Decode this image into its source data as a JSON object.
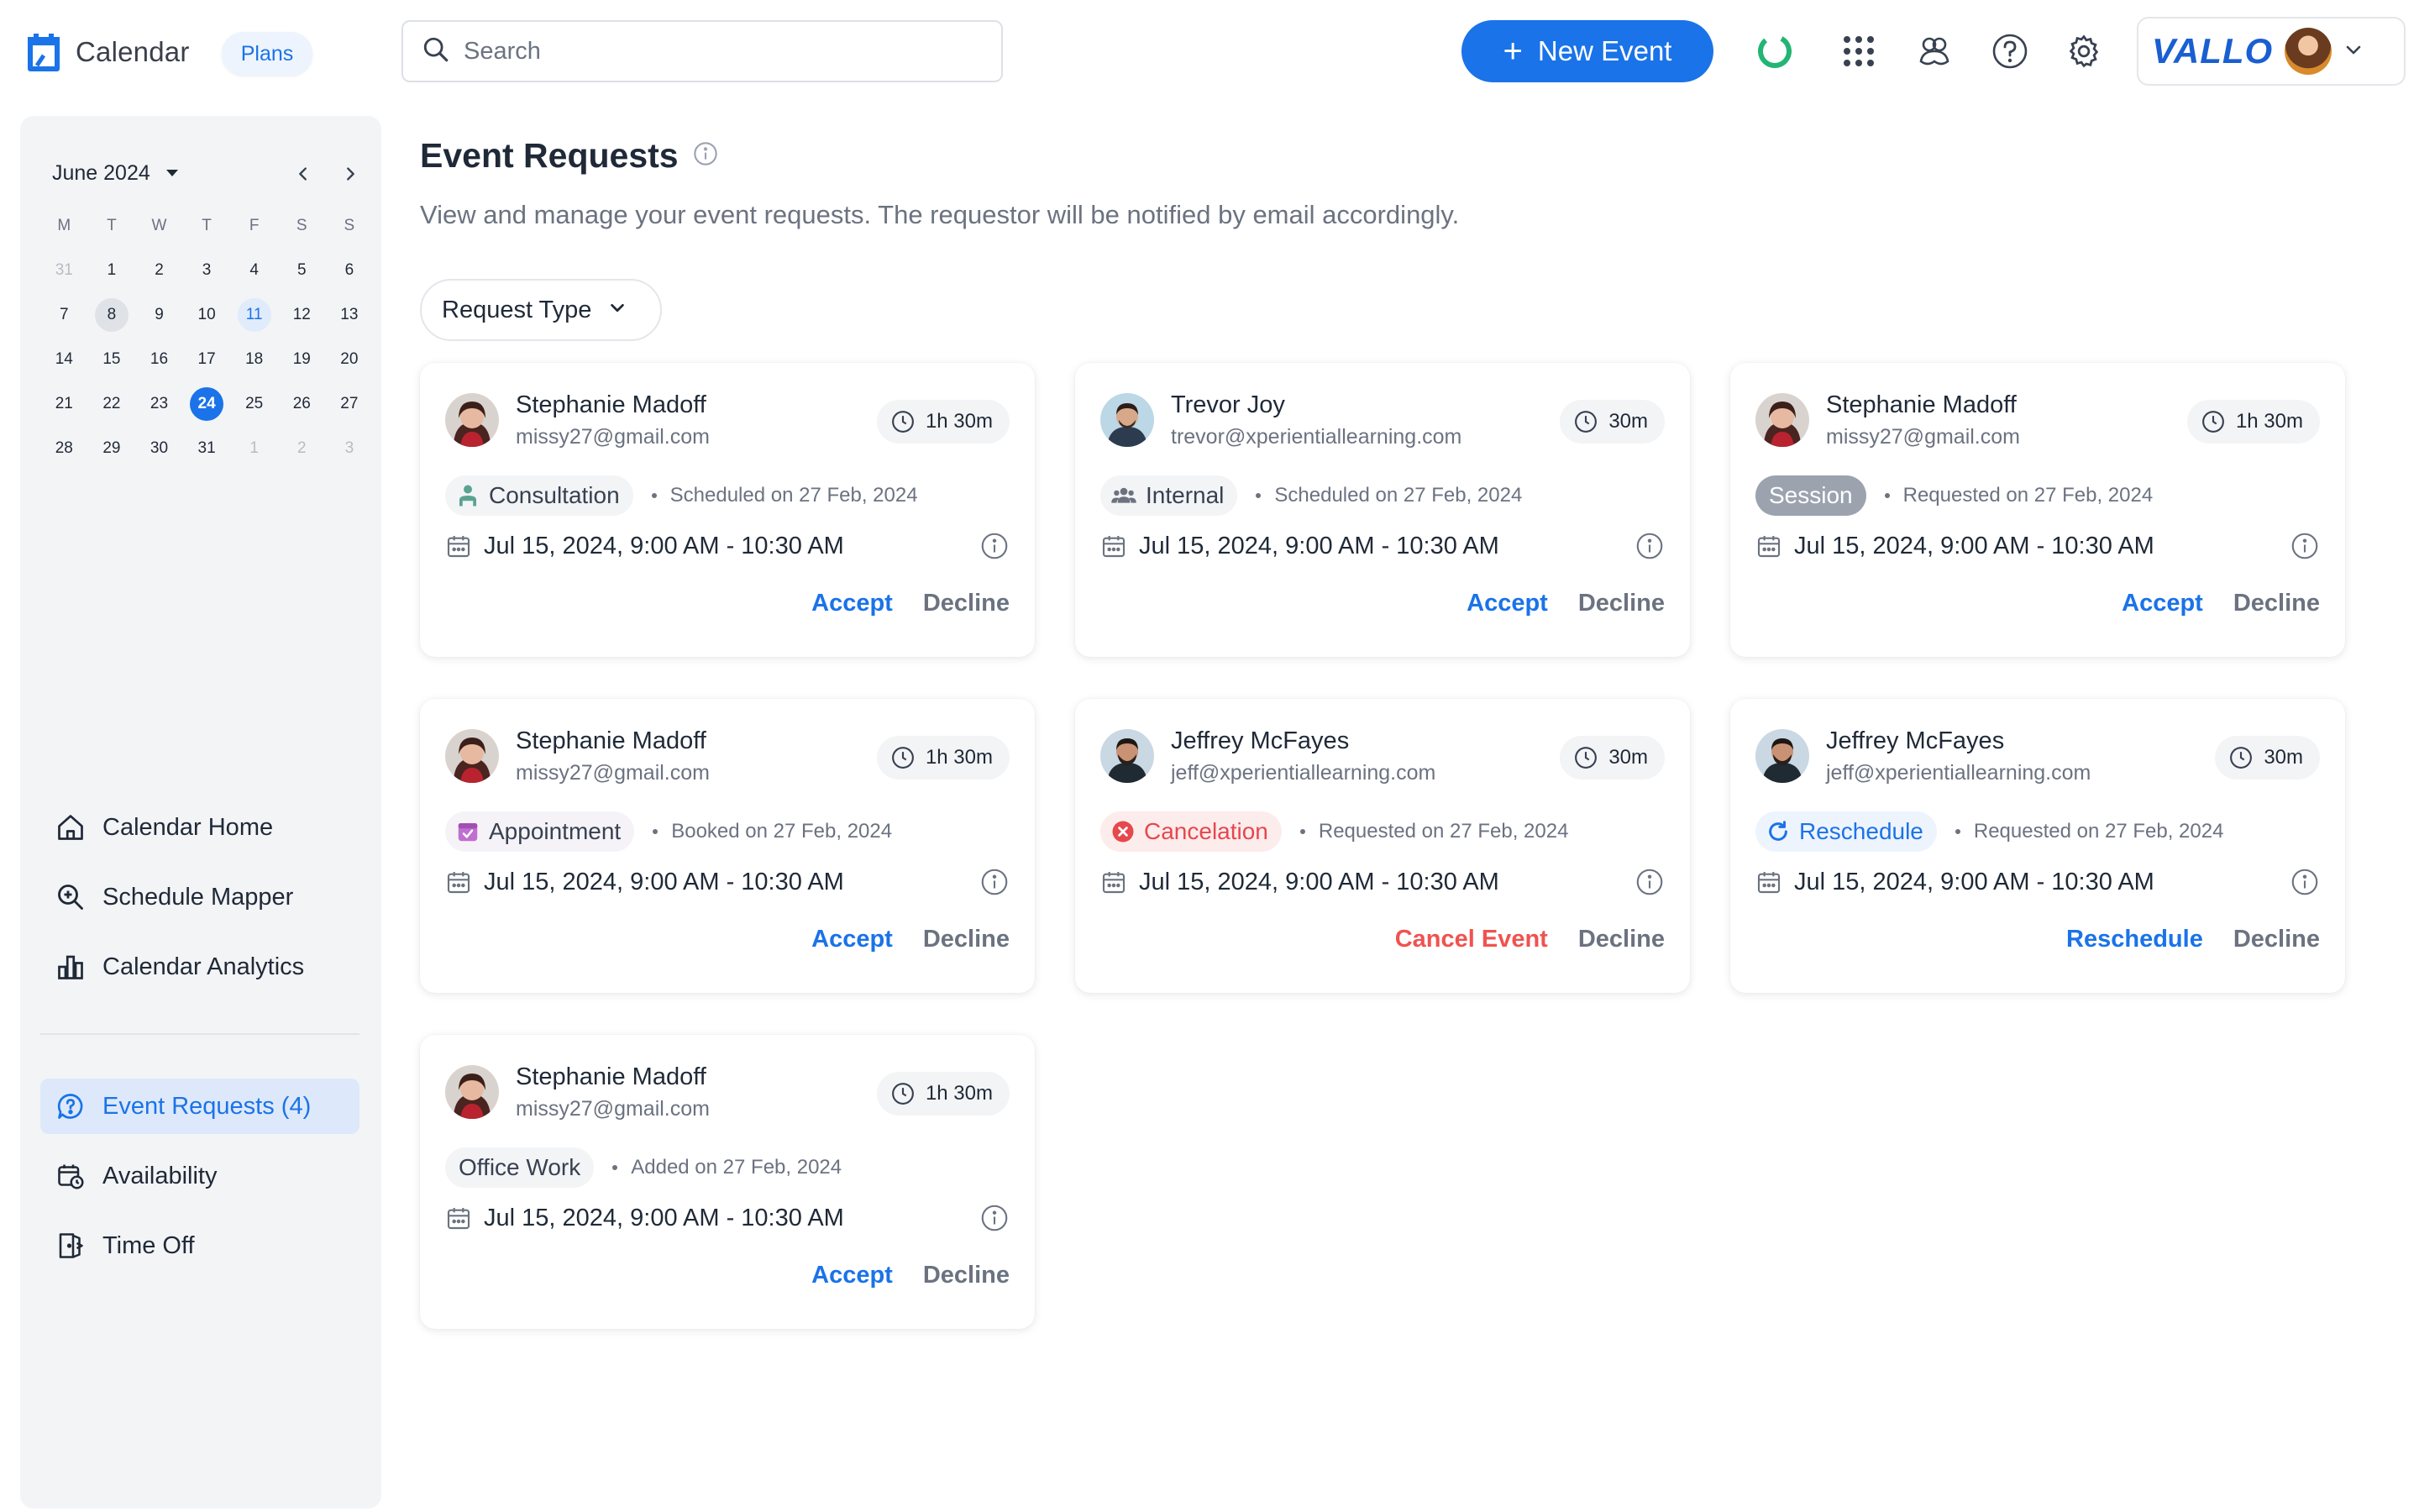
{
  "app": {
    "name": "Calendar",
    "plan_chip": "Plans",
    "brand": "VALLO"
  },
  "search": {
    "placeholder": "Search"
  },
  "toolbar": {
    "new_event_label": "New Event"
  },
  "colors": {
    "accent": "#1a73e8",
    "danger": "#ef5350",
    "sidebar_bg": "#f3f4f6"
  },
  "mini_calendar": {
    "month_label": "June 2024",
    "weekdays": [
      "M",
      "T",
      "W",
      "T",
      "F",
      "S",
      "S"
    ],
    "weeks": [
      [
        "31",
        "1",
        "2",
        "3",
        "4",
        "5",
        "6"
      ],
      [
        "7",
        "8",
        "9",
        "10",
        "11",
        "12",
        "13"
      ],
      [
        "14",
        "15",
        "16",
        "17",
        "18",
        "19",
        "20"
      ],
      [
        "21",
        "22",
        "23",
        "24",
        "25",
        "26",
        "27"
      ],
      [
        "28",
        "29",
        "30",
        "31",
        "1",
        "2",
        "3"
      ]
    ]
  },
  "nav": {
    "primary": [
      {
        "label": "Calendar Home",
        "icon": "home-icon"
      },
      {
        "label": "Schedule Mapper",
        "icon": "search-zoom-icon"
      },
      {
        "label": "Calendar Analytics",
        "icon": "bar-chart-icon"
      }
    ],
    "secondary": [
      {
        "label": "Event Requests (4)",
        "icon": "question-chat-icon"
      },
      {
        "label": "Availability",
        "icon": "calendar-clock-icon"
      },
      {
        "label": "Time Off",
        "icon": "door-exit-icon"
      }
    ]
  },
  "page": {
    "title": "Event Requests",
    "subtitle": "View and manage your event requests. The requestor will be notified by email accordingly.",
    "filter_label": "Request Type"
  },
  "cards": [
    {
      "name": "Stephanie Madoff",
      "email": "missy27@gmail.com",
      "duration": "1h 30m",
      "tag": "Consultation",
      "status": "Scheduled on 27 Feb, 2024",
      "when": "Jul 15, 2024, 9:00 AM - 10:30 AM",
      "primary_action": "Accept",
      "secondary_action": "Decline"
    },
    {
      "name": "Trevor Joy",
      "email": "trevor@xperientiallearning.com",
      "duration": "30m",
      "tag": "Internal",
      "status": "Scheduled on 27 Feb, 2024",
      "when": "Jul 15, 2024, 9:00 AM - 10:30 AM",
      "primary_action": "Accept",
      "secondary_action": "Decline"
    },
    {
      "name": "Stephanie Madoff",
      "email": "missy27@gmail.com",
      "duration": "1h 30m",
      "tag": "Session",
      "status": "Requested on 27 Feb, 2024",
      "when": "Jul 15, 2024, 9:00 AM - 10:30 AM",
      "primary_action": "Accept",
      "secondary_action": "Decline"
    },
    {
      "name": "Stephanie Madoff",
      "email": "missy27@gmail.com",
      "duration": "1h 30m",
      "tag": "Appointment",
      "status": "Booked on 27 Feb, 2024",
      "when": "Jul 15, 2024, 9:00 AM - 10:30 AM",
      "primary_action": "Accept",
      "secondary_action": "Decline"
    },
    {
      "name": "Jeffrey McFayes",
      "email": "jeff@xperientiallearning.com",
      "duration": "30m",
      "tag": "Cancelation",
      "status": "Requested on 27 Feb, 2024",
      "when": "Jul 15, 2024, 9:00 AM - 10:30 AM",
      "primary_action": "Cancel Event",
      "secondary_action": "Decline"
    },
    {
      "name": "Jeffrey McFayes",
      "email": "jeff@xperientiallearning.com",
      "duration": "30m",
      "tag": "Reschedule",
      "status": "Requested on 27 Feb, 2024",
      "when": "Jul 15, 2024, 9:00 AM - 10:30 AM",
      "primary_action": "Reschedule",
      "secondary_action": "Decline"
    },
    {
      "name": "Stephanie Madoff",
      "email": "missy27@gmail.com",
      "duration": "1h 30m",
      "tag": "Office Work",
      "status": "Added on 27 Feb, 2024",
      "when": "Jul 15, 2024, 9:00 AM - 10:30 AM",
      "primary_action": "Accept",
      "secondary_action": "Decline"
    }
  ]
}
